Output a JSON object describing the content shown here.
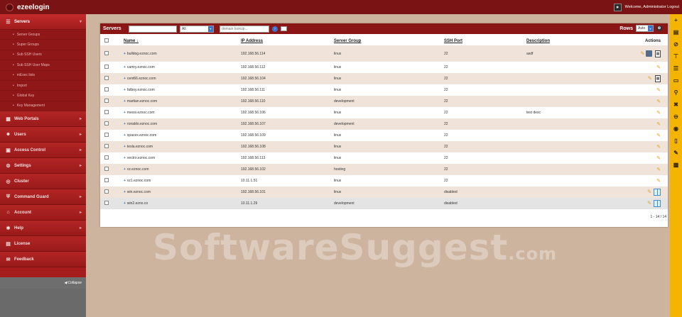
{
  "app": {
    "name": "ezeelogin",
    "welcome": "Welcome, Administrator Logout"
  },
  "sidebar": {
    "items": [
      {
        "label": "Servers",
        "icon": "servers-icon",
        "active": true
      },
      {
        "label": "Web Portals",
        "icon": "web-portals-icon"
      },
      {
        "label": "Users",
        "icon": "users-icon"
      },
      {
        "label": "Access Control",
        "icon": "access-control-icon"
      },
      {
        "label": "Settings",
        "icon": "settings-icon"
      },
      {
        "label": "Cluster",
        "icon": "cluster-icon"
      },
      {
        "label": "Command Guard",
        "icon": "command-guard-icon"
      },
      {
        "label": "Account",
        "icon": "account-icon"
      },
      {
        "label": "Help",
        "icon": "help-icon"
      },
      {
        "label": "License",
        "icon": "license-icon"
      },
      {
        "label": "Feedback",
        "icon": "feedback-icon"
      }
    ],
    "sub_items": [
      "Server Groups",
      "Super Groups",
      "Sub SSH Users",
      "Sub SSH User Maps",
      "mExec lists",
      "Import",
      "Global Key",
      "Key Management"
    ],
    "collapse_label": "Collapse"
  },
  "panel": {
    "title": "Servers",
    "search_value": "",
    "group_filter": "All",
    "domain_placeholder": "domain lookup...",
    "rows_label": "Rows",
    "rows_value": "Auto"
  },
  "table": {
    "headers": {
      "name": "Name",
      "ip": "IP Address",
      "group": "Server Group",
      "ssh": "SSH Port",
      "desc": "Description",
      "actions": "Actions"
    },
    "rows": [
      {
        "name": "bulldog.eznoc.com",
        "ip": "192.168.56.114",
        "group": "linux",
        "ssh": "22",
        "desc": "asdf"
      },
      {
        "name": "camry.eznoc.com",
        "ip": "192.168.56.112",
        "group": "linux",
        "ssh": "22",
        "desc": ""
      },
      {
        "name": "cent66.eznoc.com",
        "ip": "192.168.56.104",
        "group": "linux",
        "ssh": "22",
        "desc": ""
      },
      {
        "name": "fatboy.eznoc.com",
        "ip": "192.168.56.111",
        "group": "linux",
        "ssh": "22",
        "desc": ""
      },
      {
        "name": "martian.eznoc.com",
        "ip": "192.168.56.110",
        "group": "development",
        "ssh": "22",
        "desc": ""
      },
      {
        "name": "messi.eznoc.com",
        "ip": "192.168.56.106",
        "group": "linux",
        "ssh": "22",
        "desc": "test desc"
      },
      {
        "name": "ronaldo.eznoc.com",
        "ip": "192.168.56.107",
        "group": "development",
        "ssh": "22",
        "desc": ""
      },
      {
        "name": "spacex.eznoc.com",
        "ip": "192.168.56.109",
        "group": "linux",
        "ssh": "22",
        "desc": ""
      },
      {
        "name": "tesla.eznoc.com",
        "ip": "192.168.56.108",
        "group": "linux",
        "ssh": "22",
        "desc": ""
      },
      {
        "name": "vectro.eznoc.com",
        "ip": "192.168.56.113",
        "group": "linux",
        "ssh": "22",
        "desc": ""
      },
      {
        "name": "vz.eznoc.com",
        "ip": "192.168.56.102",
        "group": "hosting",
        "ssh": "22",
        "desc": ""
      },
      {
        "name": "vz1.eznoc.com",
        "ip": "10.11.1.51",
        "group": "linux",
        "ssh": "22",
        "desc": ""
      },
      {
        "name": "win.eznoc.com",
        "ip": "192.168.56.101",
        "group": "linux",
        "ssh": "disabled",
        "desc": ""
      },
      {
        "name": "win2.ezno.co",
        "ip": "10.11.1.29",
        "group": "development",
        "ssh": "disabled",
        "desc": ""
      }
    ],
    "pagination": "1 - 14 / 14"
  },
  "watermark": {
    "main": "SoftwareSuggest",
    "suffix": ".com"
  },
  "colors": {
    "brand": "#a51c1c",
    "topbar": "#7a1414",
    "toolbar": "#f4b400",
    "link": "#3d73c9"
  },
  "right_toolbar": [
    "plus-icon",
    "server-icon",
    "block-icon",
    "filter-icon",
    "layers-icon",
    "barcode-icon",
    "key-icon",
    "tools-icon",
    "minus-circle-icon",
    "gauge-icon",
    "trash-icon",
    "user-edit-icon",
    "group-icon"
  ]
}
